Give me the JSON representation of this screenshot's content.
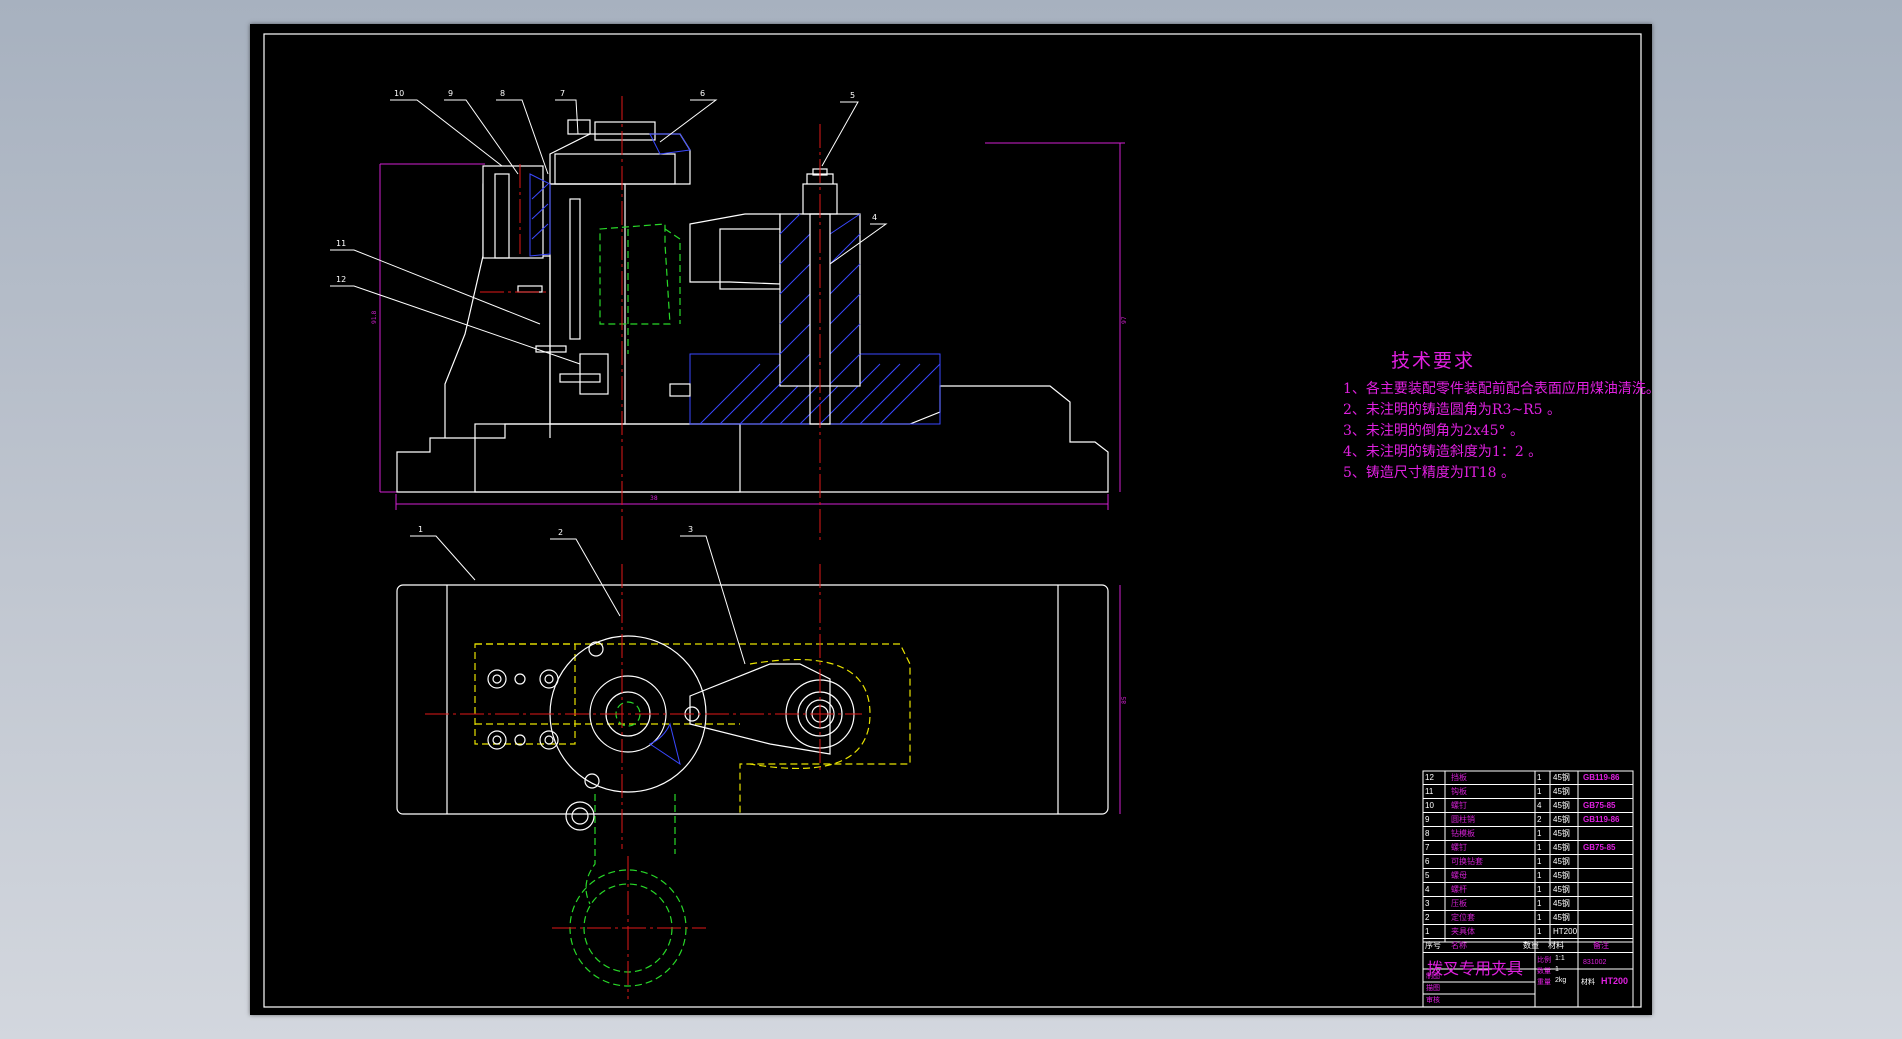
{
  "colors": {
    "background": "#b8c0cc",
    "sheet": "#000000",
    "outline": "#ffffff",
    "centerline": "#e01818",
    "hidden_green": "#28d828",
    "hidden_yellow": "#e8e200",
    "dimension": "#d020d0",
    "hatch": "#3a48ff",
    "text_magenta": "#e020e0"
  },
  "part_callouts": [
    "1",
    "2",
    "3",
    "4",
    "5",
    "6",
    "7",
    "8",
    "9",
    "10",
    "11",
    "12"
  ],
  "tech_requirements": {
    "title": "技术要求",
    "notes": [
      "1、各主要装配零件装配前配合表面应用煤油清洗。",
      "2、未注明的铸造圆角为R3~R5 。",
      "3、未注明的倒角为2x45° 。",
      "4、未注明的铸造斜度为1：2 。",
      "5、铸造尺寸精度为IT18 。"
    ]
  },
  "parts_list": [
    {
      "no": "12",
      "name": "挡板",
      "qty": "1",
      "material": "45钢",
      "standard": "GB119-86"
    },
    {
      "no": "11",
      "name": "钩板",
      "qty": "1",
      "material": "45钢",
      "standard": ""
    },
    {
      "no": "10",
      "name": "螺钉",
      "qty": "4",
      "material": "45钢",
      "standard": "GB75-85"
    },
    {
      "no": "9",
      "name": "圆柱销",
      "qty": "2",
      "material": "45钢",
      "standard": "GB119-86"
    },
    {
      "no": "8",
      "name": "钻模板",
      "qty": "1",
      "material": "45钢",
      "standard": ""
    },
    {
      "no": "7",
      "name": "螺钉",
      "qty": "1",
      "material": "45钢",
      "standard": "GB75-85"
    },
    {
      "no": "6",
      "name": "可换钻套",
      "qty": "1",
      "material": "45钢",
      "standard": ""
    },
    {
      "no": "5",
      "name": "螺母",
      "qty": "1",
      "material": "45钢",
      "standard": ""
    },
    {
      "no": "4",
      "name": "螺杆",
      "qty": "1",
      "material": "45钢",
      "standard": ""
    },
    {
      "no": "3",
      "name": "压板",
      "qty": "1",
      "material": "45钢",
      "standard": ""
    },
    {
      "no": "2",
      "name": "定位套",
      "qty": "1",
      "material": "45钢",
      "standard": ""
    },
    {
      "no": "1",
      "name": "夹具体",
      "qty": "1",
      "material": "HT200",
      "standard": ""
    }
  ],
  "title_block": {
    "header_no": "序号",
    "header_name": "名称",
    "header_qty": "数量",
    "header_material": "材料",
    "header_remark": "备注",
    "drawing_name": "拨叉专用夹具",
    "scale_label": "比例",
    "scale_value": "1:1",
    "qty_label": "数量",
    "qty_value": "1",
    "drawing_no": "831002",
    "weight_label": "重量",
    "weight_value": "2kg",
    "material_label": "材料",
    "material_value": "HT200",
    "drawn_label": "制图",
    "checked_label": "描图",
    "approved_label": "审核"
  }
}
